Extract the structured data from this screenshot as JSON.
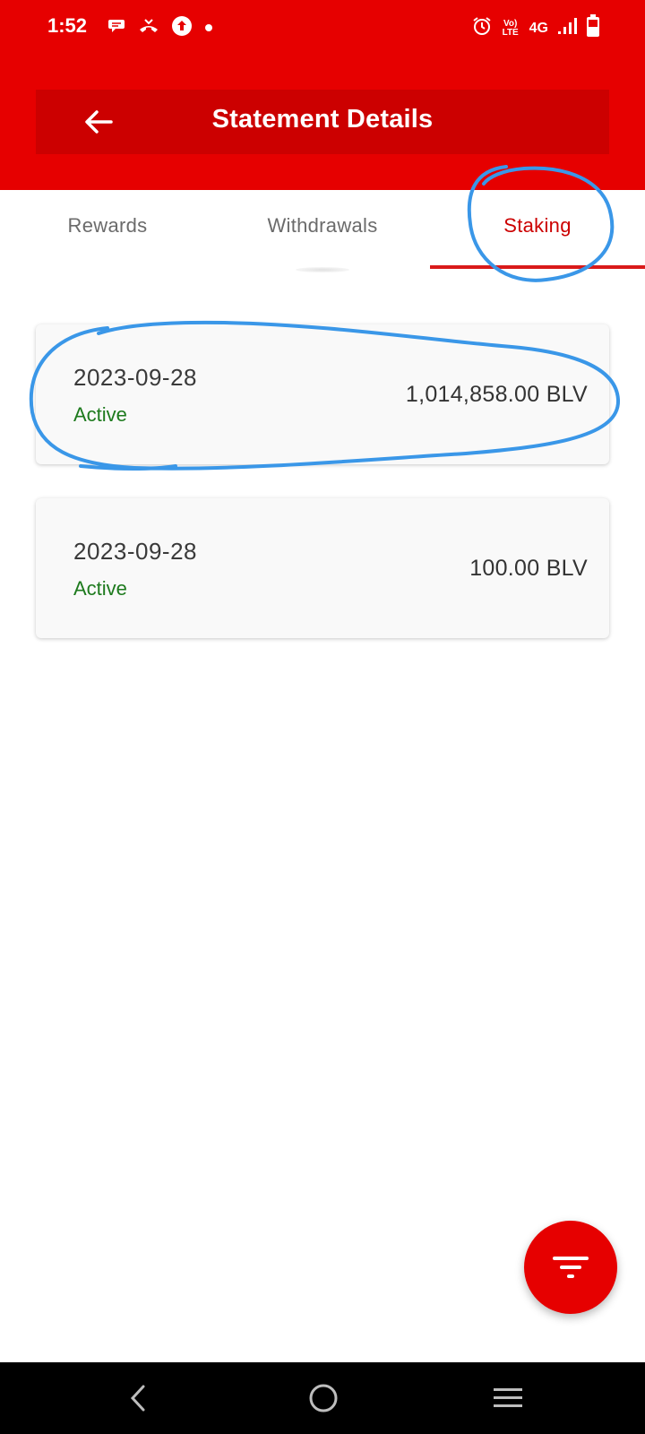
{
  "status_bar": {
    "time": "1:52",
    "network": "4G",
    "volte": "Vo) LTE",
    "left_icons": [
      "chat-bubble-icon",
      "missed-call-icon",
      "upload-icon",
      "dot-icon"
    ],
    "right_icons": [
      "alarm-icon",
      "volte-icon",
      "signal-icon",
      "battery-icon"
    ]
  },
  "header": {
    "title": "Statement Details",
    "back_icon": "arrow-left-icon"
  },
  "tabs": [
    {
      "label": "Rewards",
      "active": false
    },
    {
      "label": "Withdrawals",
      "active": false
    },
    {
      "label": "Staking",
      "active": true
    }
  ],
  "staking_items": [
    {
      "date": "2023-09-28",
      "status": "Active",
      "amount": "1,014,858.00 BLV"
    },
    {
      "date": "2023-09-28",
      "status": "Active",
      "amount": "100.00 BLV"
    }
  ],
  "fab": {
    "icon": "filter-icon"
  },
  "nav_bar": {
    "icons": [
      "back-nav-icon",
      "home-nav-icon",
      "recents-nav-icon"
    ]
  },
  "colors": {
    "brand_red": "#e60000",
    "header_red": "#cc0000",
    "active_green": "#1d7a1d",
    "annotation_blue": "#3a97e8"
  }
}
